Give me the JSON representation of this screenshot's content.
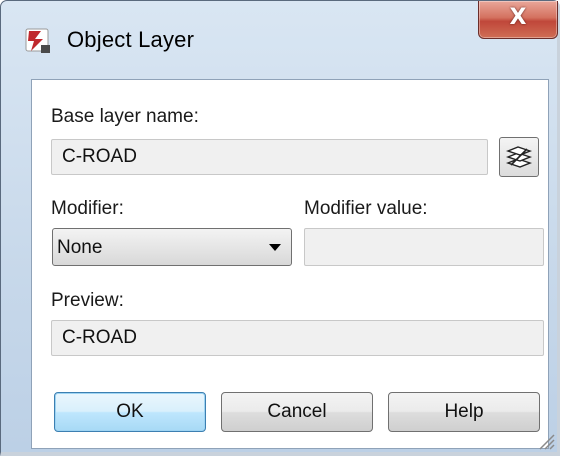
{
  "window": {
    "title": "Object Layer",
    "close_glyph": "X"
  },
  "form": {
    "base_layer_label": "Base layer name:",
    "base_layer_value": "C-ROAD",
    "modifier_label": "Modifier:",
    "modifier_selected": "None",
    "modifier_value_label": "Modifier value:",
    "modifier_value": "",
    "preview_label": "Preview:",
    "preview_value": "C-ROAD"
  },
  "buttons": {
    "ok": "OK",
    "cancel": "Cancel",
    "help": "Help"
  },
  "icons": {
    "app": "app-icon",
    "layer_select": "layer-stack-icon",
    "dropdown": "chevron-down-icon",
    "resize": "resize-grip-icon"
  },
  "colors": {
    "title_bg": "#c7d8ea",
    "close_red": "#c0473a",
    "default_button": "#bee6fd"
  }
}
